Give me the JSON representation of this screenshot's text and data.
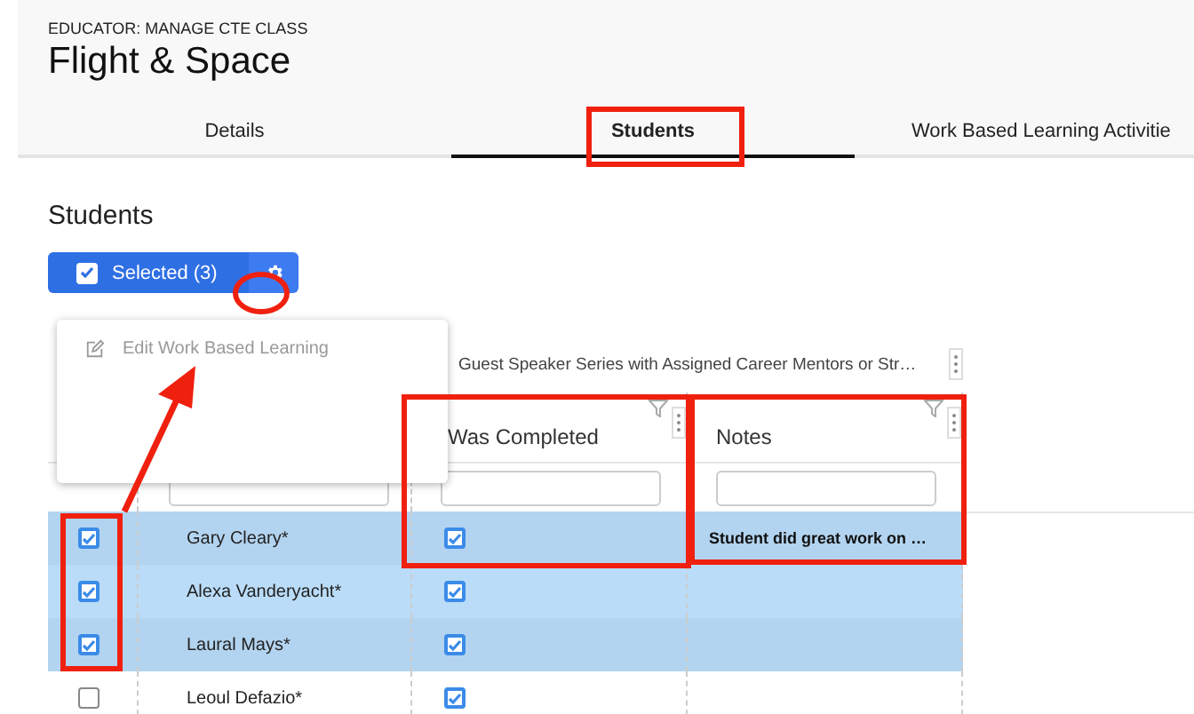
{
  "header": {
    "breadcrumb": "EDUCATOR: MANAGE CTE CLASS",
    "title": "Flight & Space"
  },
  "tabs": [
    {
      "label": "Details",
      "selected": false
    },
    {
      "label": "Students",
      "selected": true
    },
    {
      "label": "Work Based Learning Activitie",
      "selected": false
    }
  ],
  "section_title": "Students",
  "selection_button": {
    "label": "Selected (3)",
    "checked": true
  },
  "menu": {
    "items": [
      {
        "label": "Edit Work Based Learning",
        "disabled": true
      }
    ]
  },
  "table": {
    "group_header": "Guest Speaker Series with Assigned Career Mentors or Str…",
    "columns": [
      "Was Completed",
      "Notes"
    ],
    "rows": [
      {
        "selected": true,
        "name": "Gary Cleary*",
        "completed": true,
        "notes": "Student did great work on …"
      },
      {
        "selected": true,
        "name": "Alexa Vanderyacht*",
        "completed": true
      },
      {
        "selected": true,
        "name": "Laural Mays*",
        "completed": true
      },
      {
        "selected": false,
        "name": "Leoul Defazio*",
        "completed": true
      }
    ]
  }
}
